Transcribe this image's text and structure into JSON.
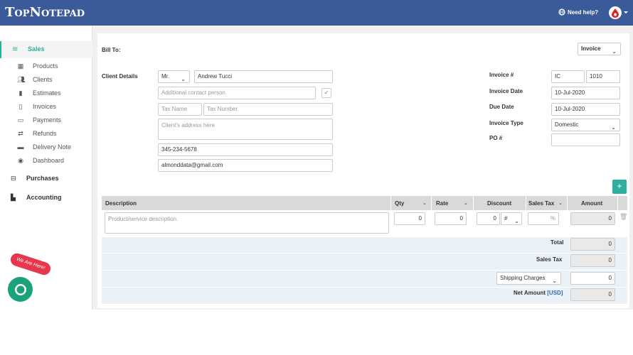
{
  "header": {
    "logo_big": "T",
    "logo_rest_1": "OP",
    "logo_big_2": "N",
    "logo_rest_2": "OTEPAD",
    "help": "Need help?"
  },
  "sidebar": {
    "sales": "Sales",
    "items": [
      "Products",
      "Clients",
      "Estimates",
      "Invoices",
      "Payments",
      "Refunds",
      "Delivery Note",
      "Dashboard"
    ],
    "purchases": "Purchases",
    "accounting": "Accounting"
  },
  "badge": "We Are Here!",
  "form": {
    "bill_to": "Bill To:",
    "doc_type": "Invoice",
    "client_details": "Client Details",
    "salutation": "Mr.",
    "name": "Andrew Tucci",
    "contact_placeholder": "Additional contact person",
    "tax_name_placeholder": "Tax Name",
    "tax_number_placeholder": "Tax Number",
    "address_placeholder": "Client's address here",
    "phone": "345-234-5678",
    "email": "almonddata@gmail.com",
    "invoice_no_label": "Invoice #",
    "invoice_prefix": "IC",
    "invoice_number": "1010",
    "invoice_date_label": "Invoice Date",
    "invoice_date": "10-Jul-2020",
    "due_date_label": "Due Date",
    "due_date": "10-Jul-2020",
    "invoice_type_label": "Invoice Type",
    "invoice_type": "Domestic",
    "po_label": "PO #",
    "po_value": ""
  },
  "table": {
    "headers": {
      "description": "Description",
      "qty": "Qty",
      "rate": "Rate",
      "discount": "Discount",
      "sales_tax": "Sales Tax",
      "amount": "Amount"
    },
    "row": {
      "description_placeholder": "Product/service description.",
      "qty": "0",
      "rate": "0",
      "discount": "0",
      "discount_type": "#",
      "tax_placeholder": "%",
      "amount": "0"
    },
    "totals": {
      "total_label": "Total",
      "total": "0",
      "sales_tax_label": "Sales Tax",
      "sales_tax": "0",
      "shipping_label": "Shipping Charges",
      "shipping": "0",
      "net_label": "Net Amount",
      "net_currency": "[USD]",
      "net": "0"
    }
  },
  "colors": {
    "topbar": "#3b5a9a",
    "accent": "#2bb0a0",
    "badge": "#e8364e",
    "chat": "#1aa37a"
  }
}
